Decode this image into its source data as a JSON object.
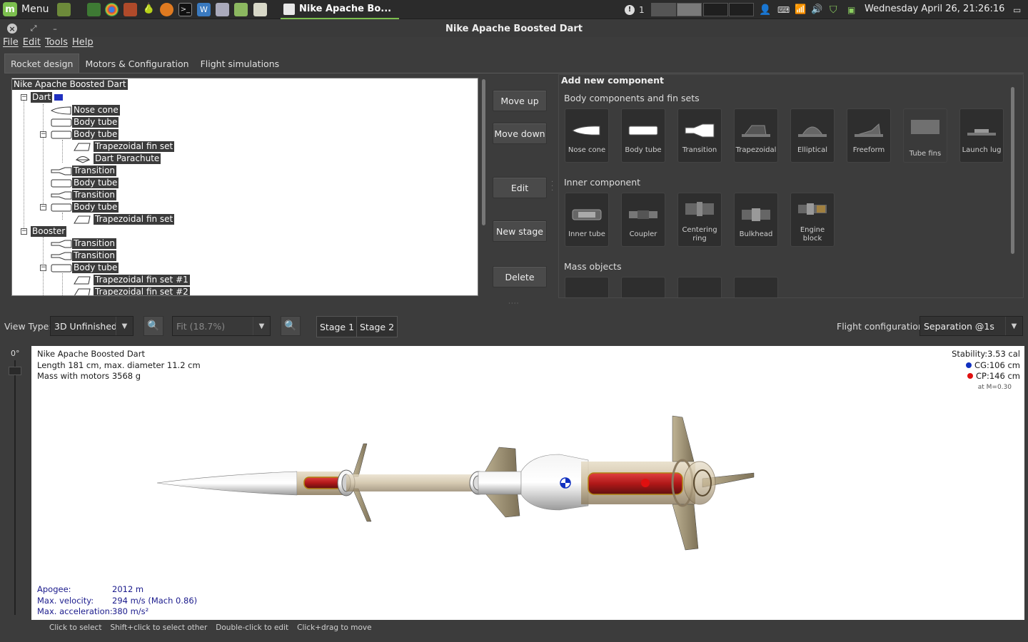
{
  "panel": {
    "menu_label": "Menu",
    "task_title": "Nike Apache Bo...",
    "alert_count": "1",
    "clock": "Wednesday April 26, 21:26:16"
  },
  "window": {
    "title": "Nike Apache Boosted Dart"
  },
  "menubar": [
    "File",
    "Edit",
    "Tools",
    "Help"
  ],
  "tabs": [
    "Rocket design",
    "Motors & Configuration",
    "Flight simulations"
  ],
  "tree": {
    "root": "Nike Apache Boosted Dart",
    "nodes": [
      "Dart",
      "Nose cone",
      "Body tube",
      "Body tube",
      "Trapezoidal fin set",
      "Dart Parachute",
      "Transition",
      "Body tube",
      "Transition",
      "Body tube",
      "Trapezoidal fin set",
      "Booster",
      "Transition",
      "Transition",
      "Body tube",
      "Trapezoidal fin set #1",
      "Trapezoidal fin set #2"
    ]
  },
  "actions": [
    "Move up",
    "Move down",
    "Edit",
    "New stage",
    "Delete"
  ],
  "palette": {
    "title": "Add new component",
    "groups": [
      "Body components and fin sets",
      "Inner component",
      "Mass objects"
    ],
    "body": [
      "Nose cone",
      "Body tube",
      "Transition",
      "Trapezoidal",
      "Elliptical",
      "Freeform",
      "Tube fins",
      "Launch lug"
    ],
    "inner": [
      "Inner tube",
      "Coupler",
      "Centering ring",
      "Bulkhead",
      "Engine block"
    ]
  },
  "toolbar": {
    "view_type_label": "View Type:",
    "view_type_value": "3D Unfinished",
    "zoom_value": "Fit (18.7%)",
    "stages": [
      "Stage 1",
      "Stage 2"
    ],
    "flight_cfg_label": "Flight configuration:",
    "flight_cfg_value": "Separation @1s"
  },
  "view": {
    "angle": "0°",
    "name": "Nike Apache Boosted Dart",
    "dims": "Length 181 cm, max. diameter 11.2 cm",
    "mass": "Mass with motors 3568 g",
    "stability": "Stability:3.53 cal",
    "cg": "CG:106 cm",
    "cp": "CP:146 cm",
    "mach": "at M=0.30",
    "apogee_label": "Apogee:",
    "apogee": "2012 m",
    "vel_label": "Max. velocity:",
    "vel": "294 m/s  (Mach 0.86)",
    "acc_label": "Max. acceleration:",
    "acc": "380 m/s²"
  },
  "status": [
    "Click to select",
    "Shift+click to select other",
    "Double-click to edit",
    "Click+drag to move"
  ],
  "colors": {
    "cg": "#1030c0",
    "cp": "#e01010",
    "accent": "#7cbf4e"
  }
}
